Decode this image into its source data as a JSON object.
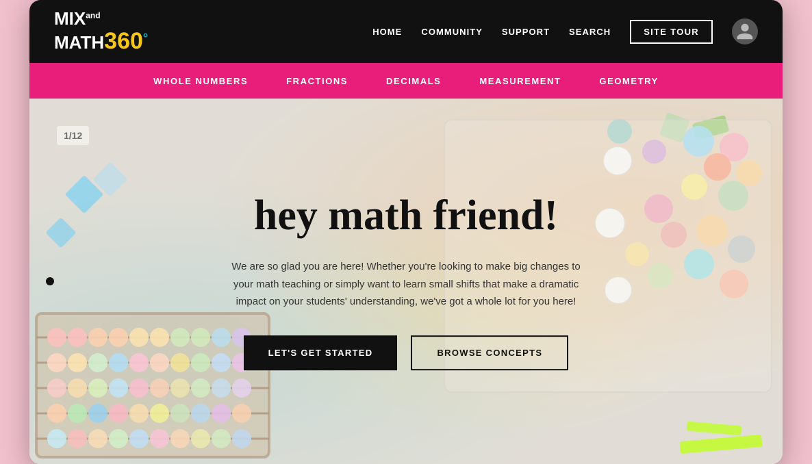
{
  "site": {
    "logo": {
      "mix": "MIX",
      "and": "and",
      "math": "MATH",
      "num": "360",
      "deg": "°"
    }
  },
  "topnav": {
    "links": [
      {
        "label": "HOME",
        "id": "home"
      },
      {
        "label": "COMMUNITY",
        "id": "community"
      },
      {
        "label": "SUPPORT",
        "id": "support"
      },
      {
        "label": "SEARCH",
        "id": "search"
      }
    ],
    "site_tour_label": "SITE TOUR"
  },
  "subnav": {
    "links": [
      {
        "label": "WHOLE NUMBERS",
        "id": "whole-numbers"
      },
      {
        "label": "FRACTIONS",
        "id": "fractions"
      },
      {
        "label": "DECIMALS",
        "id": "decimals"
      },
      {
        "label": "MEASUREMENT",
        "id": "measurement"
      },
      {
        "label": "GEOMETRY",
        "id": "geometry"
      }
    ]
  },
  "hero": {
    "title": "hey math friend!",
    "subtitle": "We are so glad you are here! Whether you're looking to make big changes to your math teaching or simply want to learn small shifts that make a dramatic impact on your students' understanding, we've got a whole lot for you here!",
    "cta_primary": "LET'S GET STARTED",
    "cta_secondary": "BROWSE CONCEPTS",
    "fraction_label": "1/12"
  }
}
